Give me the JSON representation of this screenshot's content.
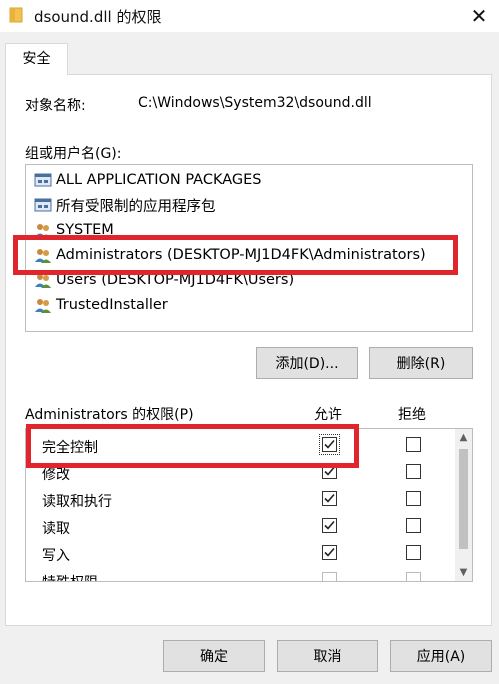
{
  "window": {
    "title": "dsound.dll 的权限",
    "close_glyph": "✕"
  },
  "tabs": [
    {
      "label": "安全",
      "active": true
    }
  ],
  "object": {
    "label": "对象名称:",
    "value": "C:\\Windows\\System32\\dsound.dll"
  },
  "groups": {
    "label": "组或用户名(G):",
    "items": [
      {
        "icon": "package-icon",
        "label": "ALL APPLICATION PACKAGES"
      },
      {
        "icon": "package-icon",
        "label": "所有受限制的应用程序包"
      },
      {
        "icon": "users-icon",
        "label": "SYSTEM"
      },
      {
        "icon": "users-icon",
        "label": "Administrators (DESKTOP-MJ1D4FK\\Administrators)",
        "selected": true
      },
      {
        "icon": "users-icon",
        "label": "Users (DESKTOP-MJ1D4FK\\Users)"
      },
      {
        "icon": "users-icon",
        "label": "TrustedInstaller"
      }
    ],
    "add_label": "添加(D)...",
    "remove_label": "删除(R)"
  },
  "permissions": {
    "header": "Administrators 的权限(P)",
    "allow_header": "允许",
    "deny_header": "拒绝",
    "rows": [
      {
        "name": "完全控制",
        "allow": true,
        "deny": false
      },
      {
        "name": "修改",
        "allow": true,
        "deny": false
      },
      {
        "name": "读取和执行",
        "allow": true,
        "deny": false
      },
      {
        "name": "读取",
        "allow": true,
        "deny": false
      },
      {
        "name": "写入",
        "allow": true,
        "deny": false
      },
      {
        "name": "特殊权限",
        "allow": false,
        "deny": false
      }
    ]
  },
  "footer": {
    "ok_label": "确定",
    "cancel_label": "取消",
    "apply_label": "应用(A)"
  },
  "colors": {
    "highlight_box": "#e0262c",
    "window_bg": "#f0f0f0",
    "panel_bg": "#ffffff"
  }
}
